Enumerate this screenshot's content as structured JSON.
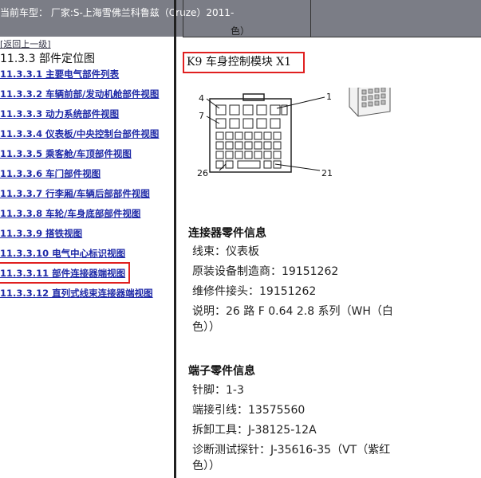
{
  "header": {
    "title": "当前车型：  厂家:S-上海雪佛兰科鲁兹（Cruze）2011-"
  },
  "sidebar": {
    "back_label": "[返回上一级]",
    "section_title": "11.3.3 部件定位图",
    "items": [
      {
        "label": "11.3.3.1 主要电气部件列表"
      },
      {
        "label": "11.3.3.2 车辆前部/发动机舱部件视图"
      },
      {
        "label": "11.3.3.3 动力系统部件视图"
      },
      {
        "label": "11.3.3.4 仪表板/中央控制台部件视图"
      },
      {
        "label": "11.3.3.5 乘客舱/车顶部件视图"
      },
      {
        "label": "11.3.3.6 车门部件视图"
      },
      {
        "label": "11.3.3.7 行李厢/车辆后部部件视图"
      },
      {
        "label": "11.3.3.8 车轮/车身底部部件视图"
      },
      {
        "label": "11.3.3.9 搭铁视图"
      },
      {
        "label": "11.3.3.10 电气中心标识视图"
      },
      {
        "label": "11.3.3.11 部件连接器端视图"
      },
      {
        "label": "11.3.3.12 直列式线束连接器端视图"
      }
    ],
    "highlight_color": "#e02020"
  },
  "content": {
    "table_remnant_text": "色）",
    "module_title": "K9 车身控制模块 X1",
    "pin_labels": {
      "p4": "4",
      "p1": "1",
      "p7": "7",
      "p26": "26",
      "p21": "21"
    },
    "connector_heading": "连接器零件信息",
    "connector_lines": [
      "线束：仪表板",
      "原装设备制造商：19151262",
      "维修件接头：19151262",
      "说明：26 路 F 0.64 2.8 系列（WH（白",
      "色））"
    ],
    "terminal_heading": "端子零件信息",
    "terminal_lines": [
      "针脚：1-3",
      "端接引线：13575560",
      "拆卸工具：J-38125-12A",
      "诊断测试探针：J-35616-35（VT（紫红",
      "色））"
    ]
  }
}
